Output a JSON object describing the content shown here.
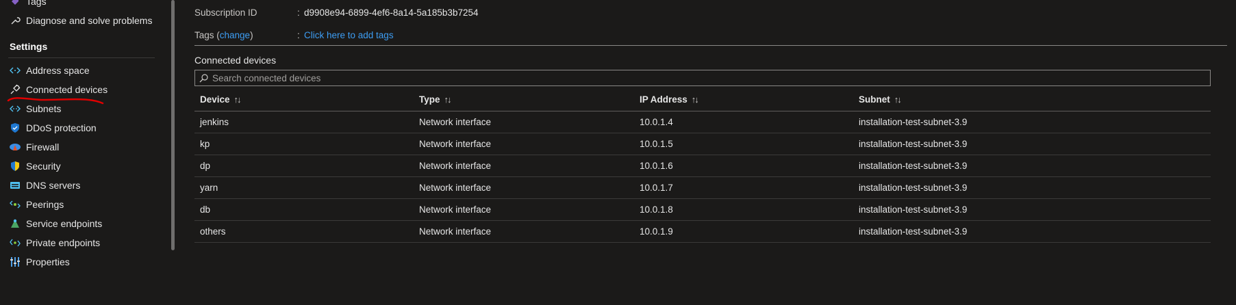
{
  "sidebar": {
    "top_items": [
      {
        "label": "Tags",
        "icon": "tag-icon"
      },
      {
        "label": "Diagnose and solve problems",
        "icon": "wrench-icon"
      }
    ],
    "section_title": "Settings",
    "items": [
      {
        "label": "Address space",
        "icon": "address-space-icon"
      },
      {
        "label": "Connected devices",
        "icon": "plug-icon"
      },
      {
        "label": "Subnets",
        "icon": "subnets-icon"
      },
      {
        "label": "DDoS protection",
        "icon": "shield-icon"
      },
      {
        "label": "Firewall",
        "icon": "firewall-icon"
      },
      {
        "label": "Security",
        "icon": "security-shield-icon"
      },
      {
        "label": "DNS servers",
        "icon": "dns-server-icon"
      },
      {
        "label": "Peerings",
        "icon": "peerings-icon"
      },
      {
        "label": "Service endpoints",
        "icon": "service-endpoints-icon"
      },
      {
        "label": "Private endpoints",
        "icon": "private-endpoints-icon"
      },
      {
        "label": "Properties",
        "icon": "properties-icon"
      }
    ]
  },
  "properties": {
    "subscription_id_label": "Subscription ID",
    "subscription_id_value": "d9908e94-6899-4ef6-8a14-5a185b3b7254",
    "tags_label_prefix": "Tags (",
    "tags_change_link": "change",
    "tags_label_suffix": ")",
    "tags_value_link": "Click here to add tags",
    "separator": ":"
  },
  "connected_devices": {
    "title": "Connected devices",
    "search_placeholder": "Search connected devices",
    "columns": [
      "Device",
      "Type",
      "IP Address",
      "Subnet"
    ],
    "sort_glyph": "↑↓",
    "rows": [
      {
        "device": "jenkins",
        "type": "Network interface",
        "ip": "10.0.1.4",
        "subnet": "installation-test-subnet-3.9"
      },
      {
        "device": "kp",
        "type": "Network interface",
        "ip": "10.0.1.5",
        "subnet": "installation-test-subnet-3.9"
      },
      {
        "device": "dp",
        "type": "Network interface",
        "ip": "10.0.1.6",
        "subnet": "installation-test-subnet-3.9"
      },
      {
        "device": "yarn",
        "type": "Network interface",
        "ip": "10.0.1.7",
        "subnet": "installation-test-subnet-3.9"
      },
      {
        "device": "db",
        "type": "Network interface",
        "ip": "10.0.1.8",
        "subnet": "installation-test-subnet-3.9"
      },
      {
        "device": "others",
        "type": "Network interface",
        "ip": "10.0.1.9",
        "subnet": "installation-test-subnet-3.9"
      }
    ]
  },
  "colors": {
    "background": "#1b1a19",
    "link": "#3d9df3",
    "annotation": "#e00000"
  }
}
